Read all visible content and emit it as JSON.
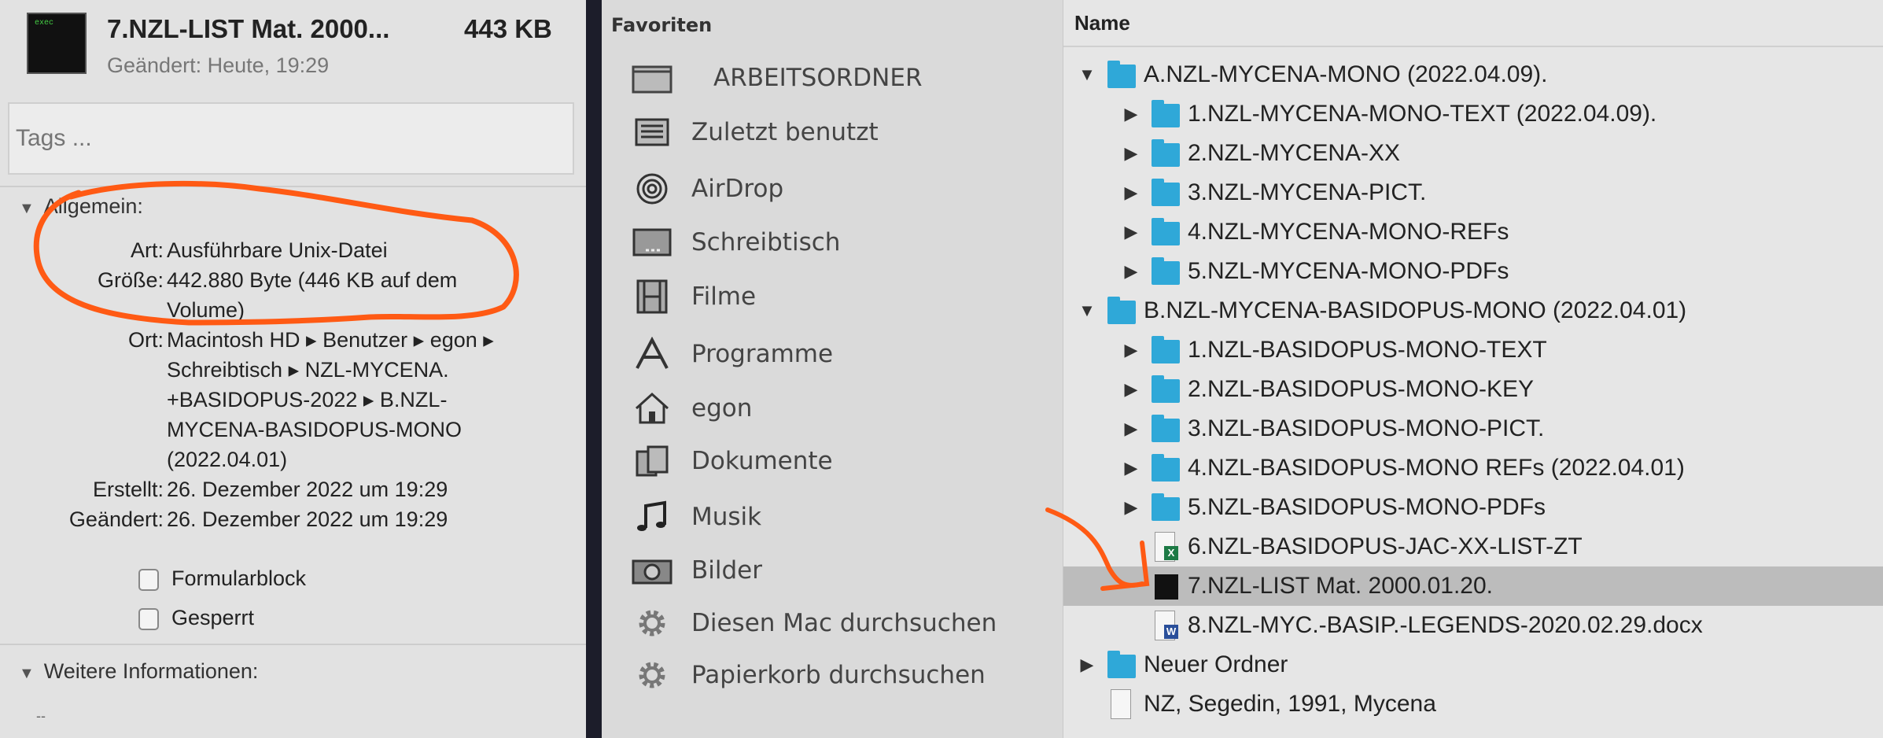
{
  "info_panel": {
    "file_icon_label": "exec",
    "title": "7.NZL-LIST Mat. 2000...",
    "size": "443 KB",
    "modified_short": "Geändert: Heute, 19:29",
    "tags_placeholder": "Tags ...",
    "general_section": "Allgemein:",
    "fields": [
      {
        "label": "Art:",
        "value": "Ausführbare Unix-Datei"
      },
      {
        "label": "Größe:",
        "value": "442.880 Byte (446 KB auf dem Volume)"
      },
      {
        "label": "Ort:",
        "value": "Macintosh HD ▸ Benutzer ▸ egon ▸ Schreibtisch ▸ NZL-MYCENA. +BASIDOPUS-2022 ▸ B.NZL-MYCENA-BASIDOPUS-MONO (2022.04.01)"
      },
      {
        "label": "Erstellt:",
        "value": "26. Dezember 2022 um 19:29"
      },
      {
        "label": "Geändert:",
        "value": "26. Dezember 2022 um 19:29"
      }
    ],
    "checkboxes": [
      {
        "label": "Formularblock",
        "checked": false
      },
      {
        "label": "Gesperrt",
        "checked": false
      }
    ],
    "more_section": "Weitere Informationen:",
    "more_value": "--"
  },
  "sidebar": {
    "heading": "Favoriten",
    "items": [
      {
        "label": "ARBEITSORDNER",
        "icon": "folder-icon"
      },
      {
        "label": "Zuletzt benutzt",
        "icon": "recents-icon"
      },
      {
        "label": "AirDrop",
        "icon": "airdrop-icon"
      },
      {
        "label": "Schreibtisch",
        "icon": "desktop-icon"
      },
      {
        "label": "Filme",
        "icon": "film-icon"
      },
      {
        "label": "Programme",
        "icon": "applications-icon"
      },
      {
        "label": "egon",
        "icon": "home-icon"
      },
      {
        "label": "Dokumente",
        "icon": "documents-icon"
      },
      {
        "label": "Musik",
        "icon": "music-icon"
      },
      {
        "label": "Bilder",
        "icon": "camera-icon"
      },
      {
        "label": "Diesen Mac durchsuchen",
        "icon": "gear-icon"
      },
      {
        "label": "Papierkorb durchsuchen",
        "icon": "gear-icon"
      }
    ]
  },
  "list": {
    "column_header": "Name",
    "folder_color": "#2fa8d8",
    "selection_color": "#bcbcbc",
    "rows": [
      {
        "name": "A.NZL-MYCENA-MONO (2022.04.09).",
        "level": 0,
        "type": "folder",
        "expanded": true
      },
      {
        "name": "1.NZL-MYCENA-MONO-TEXT (2022.04.09).",
        "level": 1,
        "type": "folder",
        "expanded": false
      },
      {
        "name": "2.NZL-MYCENA-XX",
        "level": 1,
        "type": "folder",
        "expanded": false
      },
      {
        "name": "3.NZL-MYCENA-PICT.",
        "level": 1,
        "type": "folder",
        "expanded": false
      },
      {
        "name": "4.NZL-MYCENA-MONO-REFs",
        "level": 1,
        "type": "folder",
        "expanded": false
      },
      {
        "name": "5.NZL-MYCENA-MONO-PDFs",
        "level": 1,
        "type": "folder",
        "expanded": false
      },
      {
        "name": "B.NZL-MYCENA-BASIDOPUS-MONO (2022.04.01)",
        "level": 0,
        "type": "folder",
        "expanded": true
      },
      {
        "name": "1.NZL-BASIDOPUS-MONO-TEXT",
        "level": 1,
        "type": "folder",
        "expanded": false
      },
      {
        "name": "2.NZL-BASIDOPUS-MONO-KEY",
        "level": 1,
        "type": "folder",
        "expanded": false
      },
      {
        "name": "3.NZL-BASIDOPUS-MONO-PICT.",
        "level": 1,
        "type": "folder",
        "expanded": false
      },
      {
        "name": "4.NZL-BASIDOPUS-MONO REFs (2022.04.01)",
        "level": 1,
        "type": "folder",
        "expanded": false
      },
      {
        "name": "5.NZL-BASIDOPUS-MONO-PDFs",
        "level": 1,
        "type": "folder",
        "expanded": false
      },
      {
        "name": "6.NZL-BASIDOPUS-JAC-XX-LIST-ZT",
        "level": 1,
        "type": "excel"
      },
      {
        "name": "7.NZL-LIST Mat. 2000.01.20.",
        "level": 1,
        "type": "executable",
        "selected": true
      },
      {
        "name": "8.NZL-MYC.-BASIP.-LEGENDS-2020.02.29.docx",
        "level": 1,
        "type": "word"
      },
      {
        "name": "Neuer Ordner",
        "level": 0,
        "type": "folder",
        "expanded": false
      },
      {
        "name": "NZ, Segedin, 1991, Mycena",
        "level": 0,
        "type": "document"
      }
    ]
  },
  "annotation_color": "#ff5a14"
}
